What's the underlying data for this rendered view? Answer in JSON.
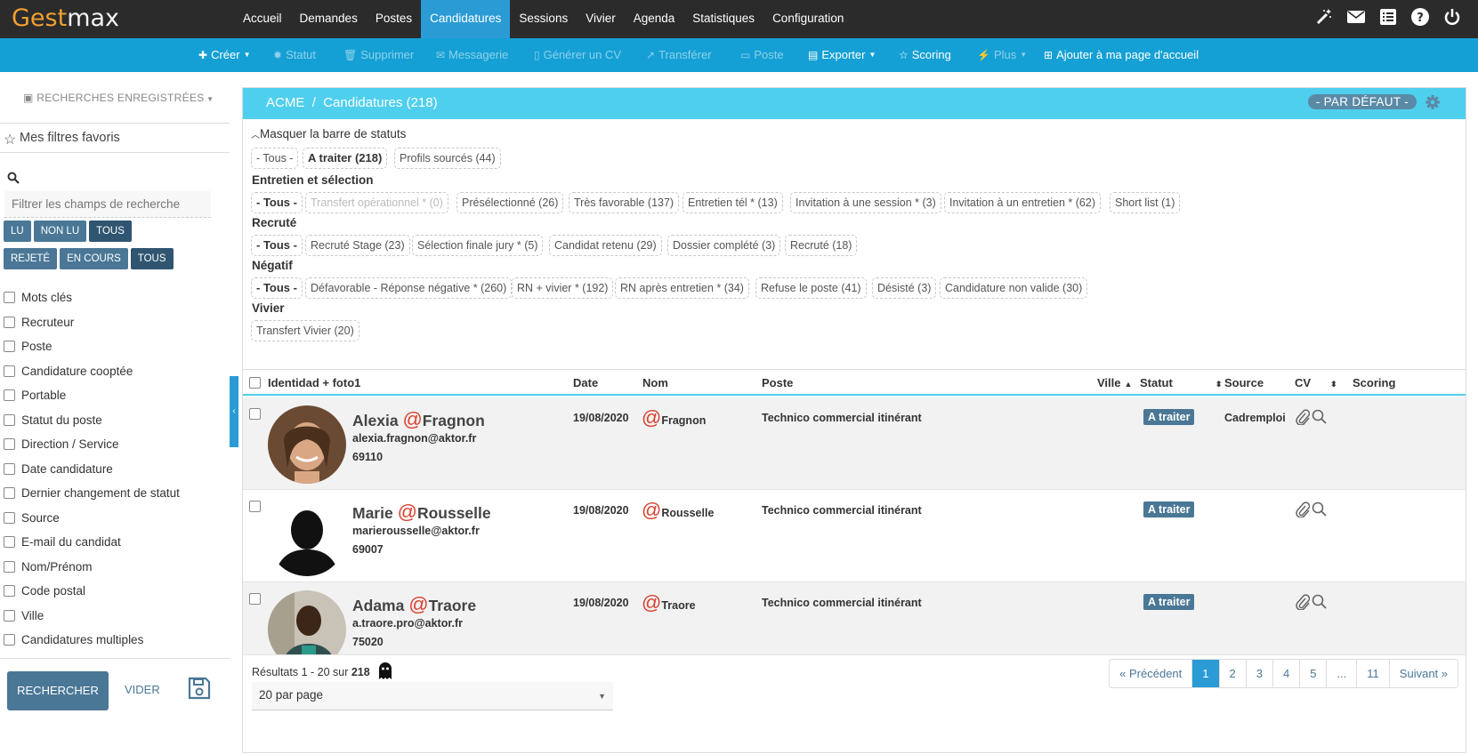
{
  "app": {
    "logo_a": "Gest",
    "logo_b": "max"
  },
  "nav": [
    "Accueil",
    "Demandes",
    "Postes",
    "Candidatures",
    "Sessions",
    "Vivier",
    "Agenda",
    "Statistiques",
    "Configuration"
  ],
  "nav_active": "Candidatures",
  "toolbar": {
    "creer": "Créer",
    "statut": "Statut",
    "supprimer": "Supprimer",
    "messagerie": "Messagerie",
    "generer_cv": "Générer un CV",
    "transferer": "Transférer",
    "poste": "Poste",
    "exporter": "Exporter",
    "scoring": "Scoring",
    "plus": "Plus",
    "ajouter": "Ajouter à ma page d'accueil"
  },
  "sidebar": {
    "saved_searches": "RECHERCHES ENREGISTRÉES",
    "favorites": "Mes filtres favoris",
    "filter_placeholder": "Filtrer les champs de recherche",
    "read_buttons": [
      "LU",
      "NON LU",
      "TOUS"
    ],
    "state_buttons": [
      "REJETÉ",
      "EN COURS",
      "TOUS"
    ],
    "filters": [
      "Mots clés",
      "Recruteur",
      "Poste",
      "Candidature cooptée",
      "Portable",
      "Statut du poste",
      "Direction / Service",
      "Date candidature",
      "Dernier changement de statut",
      "Source",
      "E-mail du candidat",
      "Nom/Prénom",
      "Code postal",
      "Ville",
      "Candidatures multiples"
    ],
    "search_button": "RECHERCHER",
    "clear_button": "VIDER"
  },
  "header": {
    "crumb_company": "ACME",
    "crumb_sep": "/",
    "crumb_page": "Candidatures (218)",
    "view": "- PAR DÉFAUT -"
  },
  "status_bar": {
    "hide_label": "Masquer la barre de statuts",
    "top": [
      "- Tous -",
      "A traiter (218)",
      "Profils sourcés (44)"
    ],
    "groups": [
      {
        "title": "Entretien et sélection",
        "pills": [
          "- Tous -",
          "Transfert opérationnel * (0)",
          "Présélectionné (26)",
          "Très favorable (137)",
          "Entretien tél * (13)",
          "Invitation à une session * (3)",
          "Invitation à un entretien * (62)",
          "Short list (1)"
        ]
      },
      {
        "title": "Recruté",
        "pills": [
          "- Tous -",
          "Recruté Stage (23)",
          "Sélection finale jury * (5)",
          "Candidat retenu (29)",
          "Dossier complété (3)",
          "Recruté (18)"
        ]
      },
      {
        "title": "Négatif",
        "pills": [
          "- Tous -",
          "Défavorable - Réponse négative * (260)",
          "RN + vivier * (192)",
          "RN après entretien * (34)",
          "Refuse le poste (41)",
          "Désisté (3)",
          "Candidature non valide (30)"
        ]
      },
      {
        "title": "Vivier",
        "pills": [
          "Transfert Vivier (20)"
        ]
      }
    ]
  },
  "table": {
    "columns": [
      "Identidad + foto1",
      "Date",
      "Nom",
      "Poste",
      "Ville",
      "Statut",
      "Source",
      "CV",
      "Scoring"
    ],
    "rows": [
      {
        "first": "Alexia",
        "at": "@",
        "last": "Fragnon",
        "email": "alexia.fragnon@aktor.fr",
        "zip": "69110",
        "date": "19/08/2020",
        "nom": "Fragnon",
        "poste": "Technico commercial itinérant",
        "statut": "A traiter",
        "source": "Cadremploi"
      },
      {
        "first": "Marie",
        "at": "@",
        "last": "Rousselle",
        "email": "marierousselle@aktor.fr",
        "zip": "69007",
        "date": "19/08/2020",
        "nom": "Rousselle",
        "poste": "Technico commercial itinérant",
        "statut": "A traiter",
        "source": ""
      },
      {
        "first": "Adama",
        "at": "@",
        "last": "Traore",
        "email": "a.traore.pro@aktor.fr",
        "zip": "75020",
        "date": "19/08/2020",
        "nom": "Traore",
        "poste": "Technico commercial itinérant",
        "statut": "A traiter",
        "source": ""
      }
    ]
  },
  "footer": {
    "results_prefix": "Résultats 1 - 20 sur ",
    "results_total": "218",
    "per_page": "20 par page",
    "pages": [
      "« Précédent",
      "1",
      "2",
      "3",
      "4",
      "5",
      "...",
      "11",
      "Suivant »"
    ],
    "current_page": "1"
  },
  "colors": {
    "topbar": "#2b2b2b",
    "toolbar": "#15a0d5",
    "header": "#4fcfee",
    "button": "#4a7796",
    "accent": "#d9402e"
  }
}
